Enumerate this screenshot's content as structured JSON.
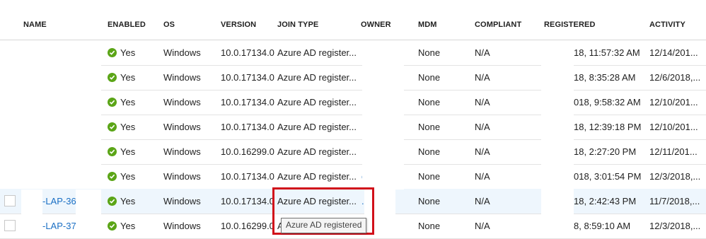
{
  "columns": [
    "NAME",
    "ENABLED",
    "OS",
    "VERSION",
    "JOIN TYPE",
    "OWNER",
    "MDM",
    "COMPLIANT",
    "REGISTERED",
    "ACTIVITY"
  ],
  "rows": [
    {
      "name": "",
      "enabled": "Yes",
      "os": "Windows",
      "version": "10.0.17134.0",
      "join": "Azure AD register...",
      "owner": "",
      "mdm": "None",
      "compliant": "N/A",
      "registered": "18, 11:57:32 AM",
      "activity": "12/14/201..."
    },
    {
      "name": "",
      "enabled": "Yes",
      "os": "Windows",
      "version": "10.0.17134.0",
      "join": "Azure AD register...",
      "owner": "..",
      "mdm": "None",
      "compliant": "N/A",
      "registered": "18, 8:35:28 AM",
      "activity": "12/6/2018,..."
    },
    {
      "name": "",
      "enabled": "Yes",
      "os": "Windows",
      "version": "10.0.17134.0",
      "join": "Azure AD register...",
      "owner": "..",
      "mdm": "None",
      "compliant": "N/A",
      "registered": "018, 9:58:32 AM",
      "activity": "12/10/201..."
    },
    {
      "name": "",
      "enabled": "Yes",
      "os": "Windows",
      "version": "10.0.17134.0",
      "join": "Azure AD register...",
      "owner": "..",
      "mdm": "None",
      "compliant": "N/A",
      "registered": "18, 12:39:18 PM",
      "activity": "12/10/201..."
    },
    {
      "name": "",
      "enabled": "Yes",
      "os": "Windows",
      "version": "10.0.16299.0",
      "join": "Azure AD register...",
      "owner": "..",
      "mdm": "None",
      "compliant": "N/A",
      "registered": "18, 2:27:20 PM",
      "activity": "12/11/201..."
    },
    {
      "name": "",
      "enabled": "Yes",
      "os": "Windows",
      "version": "10.0.17134.0",
      "join": "Azure AD register...",
      "owner": "e",
      "mdm": "None",
      "compliant": "N/A",
      "registered": "018, 3:01:54 PM",
      "activity": "12/3/2018,..."
    },
    {
      "name": "-LAP-36",
      "enabled": "Yes",
      "os": "Windows",
      "version": "10.0.17134.0",
      "join": "Azure AD register...",
      "owner": "..",
      "mdm": "None",
      "compliant": "N/A",
      "registered": "18, 2:42:43 PM",
      "activity": "11/7/2018,..."
    },
    {
      "name": "-LAP-37",
      "enabled": "Yes",
      "os": "Windows",
      "version": "10.0.16299.0",
      "join": "Az",
      "owner": "..",
      "mdm": "None",
      "compliant": "N/A",
      "registered": "8, 8:59:10 AM",
      "activity": "12/3/2018,..."
    }
  ],
  "tooltip": "Azure AD registered",
  "colors": {
    "accent_link": "#1a6fc4",
    "check_green": "#5ba517",
    "highlight_red": "#d1101a"
  },
  "icons": {
    "enabled": "check-circle-icon"
  }
}
